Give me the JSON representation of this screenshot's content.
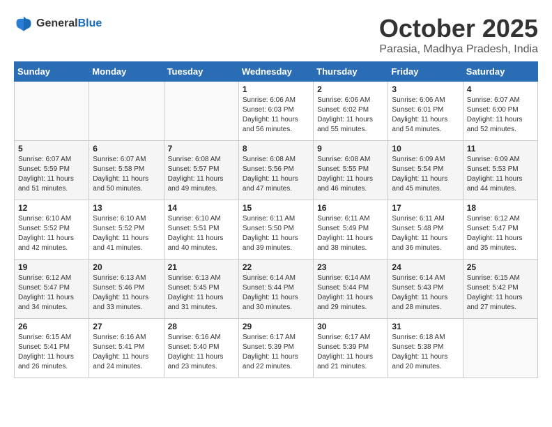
{
  "header": {
    "logo_general": "General",
    "logo_blue": "Blue",
    "title": "October 2025",
    "subtitle": "Parasia, Madhya Pradesh, India"
  },
  "days_of_week": [
    "Sunday",
    "Monday",
    "Tuesday",
    "Wednesday",
    "Thursday",
    "Friday",
    "Saturday"
  ],
  "weeks": [
    [
      {
        "day": "",
        "sunrise": "",
        "sunset": "",
        "daylight": ""
      },
      {
        "day": "",
        "sunrise": "",
        "sunset": "",
        "daylight": ""
      },
      {
        "day": "",
        "sunrise": "",
        "sunset": "",
        "daylight": ""
      },
      {
        "day": "1",
        "sunrise": "Sunrise: 6:06 AM",
        "sunset": "Sunset: 6:03 PM",
        "daylight": "Daylight: 11 hours and 56 minutes."
      },
      {
        "day": "2",
        "sunrise": "Sunrise: 6:06 AM",
        "sunset": "Sunset: 6:02 PM",
        "daylight": "Daylight: 11 hours and 55 minutes."
      },
      {
        "day": "3",
        "sunrise": "Sunrise: 6:06 AM",
        "sunset": "Sunset: 6:01 PM",
        "daylight": "Daylight: 11 hours and 54 minutes."
      },
      {
        "day": "4",
        "sunrise": "Sunrise: 6:07 AM",
        "sunset": "Sunset: 6:00 PM",
        "daylight": "Daylight: 11 hours and 52 minutes."
      }
    ],
    [
      {
        "day": "5",
        "sunrise": "Sunrise: 6:07 AM",
        "sunset": "Sunset: 5:59 PM",
        "daylight": "Daylight: 11 hours and 51 minutes."
      },
      {
        "day": "6",
        "sunrise": "Sunrise: 6:07 AM",
        "sunset": "Sunset: 5:58 PM",
        "daylight": "Daylight: 11 hours and 50 minutes."
      },
      {
        "day": "7",
        "sunrise": "Sunrise: 6:08 AM",
        "sunset": "Sunset: 5:57 PM",
        "daylight": "Daylight: 11 hours and 49 minutes."
      },
      {
        "day": "8",
        "sunrise": "Sunrise: 6:08 AM",
        "sunset": "Sunset: 5:56 PM",
        "daylight": "Daylight: 11 hours and 47 minutes."
      },
      {
        "day": "9",
        "sunrise": "Sunrise: 6:08 AM",
        "sunset": "Sunset: 5:55 PM",
        "daylight": "Daylight: 11 hours and 46 minutes."
      },
      {
        "day": "10",
        "sunrise": "Sunrise: 6:09 AM",
        "sunset": "Sunset: 5:54 PM",
        "daylight": "Daylight: 11 hours and 45 minutes."
      },
      {
        "day": "11",
        "sunrise": "Sunrise: 6:09 AM",
        "sunset": "Sunset: 5:53 PM",
        "daylight": "Daylight: 11 hours and 44 minutes."
      }
    ],
    [
      {
        "day": "12",
        "sunrise": "Sunrise: 6:10 AM",
        "sunset": "Sunset: 5:52 PM",
        "daylight": "Daylight: 11 hours and 42 minutes."
      },
      {
        "day": "13",
        "sunrise": "Sunrise: 6:10 AM",
        "sunset": "Sunset: 5:52 PM",
        "daylight": "Daylight: 11 hours and 41 minutes."
      },
      {
        "day": "14",
        "sunrise": "Sunrise: 6:10 AM",
        "sunset": "Sunset: 5:51 PM",
        "daylight": "Daylight: 11 hours and 40 minutes."
      },
      {
        "day": "15",
        "sunrise": "Sunrise: 6:11 AM",
        "sunset": "Sunset: 5:50 PM",
        "daylight": "Daylight: 11 hours and 39 minutes."
      },
      {
        "day": "16",
        "sunrise": "Sunrise: 6:11 AM",
        "sunset": "Sunset: 5:49 PM",
        "daylight": "Daylight: 11 hours and 38 minutes."
      },
      {
        "day": "17",
        "sunrise": "Sunrise: 6:11 AM",
        "sunset": "Sunset: 5:48 PM",
        "daylight": "Daylight: 11 hours and 36 minutes."
      },
      {
        "day": "18",
        "sunrise": "Sunrise: 6:12 AM",
        "sunset": "Sunset: 5:47 PM",
        "daylight": "Daylight: 11 hours and 35 minutes."
      }
    ],
    [
      {
        "day": "19",
        "sunrise": "Sunrise: 6:12 AM",
        "sunset": "Sunset: 5:47 PM",
        "daylight": "Daylight: 11 hours and 34 minutes."
      },
      {
        "day": "20",
        "sunrise": "Sunrise: 6:13 AM",
        "sunset": "Sunset: 5:46 PM",
        "daylight": "Daylight: 11 hours and 33 minutes."
      },
      {
        "day": "21",
        "sunrise": "Sunrise: 6:13 AM",
        "sunset": "Sunset: 5:45 PM",
        "daylight": "Daylight: 11 hours and 31 minutes."
      },
      {
        "day": "22",
        "sunrise": "Sunrise: 6:14 AM",
        "sunset": "Sunset: 5:44 PM",
        "daylight": "Daylight: 11 hours and 30 minutes."
      },
      {
        "day": "23",
        "sunrise": "Sunrise: 6:14 AM",
        "sunset": "Sunset: 5:44 PM",
        "daylight": "Daylight: 11 hours and 29 minutes."
      },
      {
        "day": "24",
        "sunrise": "Sunrise: 6:14 AM",
        "sunset": "Sunset: 5:43 PM",
        "daylight": "Daylight: 11 hours and 28 minutes."
      },
      {
        "day": "25",
        "sunrise": "Sunrise: 6:15 AM",
        "sunset": "Sunset: 5:42 PM",
        "daylight": "Daylight: 11 hours and 27 minutes."
      }
    ],
    [
      {
        "day": "26",
        "sunrise": "Sunrise: 6:15 AM",
        "sunset": "Sunset: 5:41 PM",
        "daylight": "Daylight: 11 hours and 26 minutes."
      },
      {
        "day": "27",
        "sunrise": "Sunrise: 6:16 AM",
        "sunset": "Sunset: 5:41 PM",
        "daylight": "Daylight: 11 hours and 24 minutes."
      },
      {
        "day": "28",
        "sunrise": "Sunrise: 6:16 AM",
        "sunset": "Sunset: 5:40 PM",
        "daylight": "Daylight: 11 hours and 23 minutes."
      },
      {
        "day": "29",
        "sunrise": "Sunrise: 6:17 AM",
        "sunset": "Sunset: 5:39 PM",
        "daylight": "Daylight: 11 hours and 22 minutes."
      },
      {
        "day": "30",
        "sunrise": "Sunrise: 6:17 AM",
        "sunset": "Sunset: 5:39 PM",
        "daylight": "Daylight: 11 hours and 21 minutes."
      },
      {
        "day": "31",
        "sunrise": "Sunrise: 6:18 AM",
        "sunset": "Sunset: 5:38 PM",
        "daylight": "Daylight: 11 hours and 20 minutes."
      },
      {
        "day": "",
        "sunrise": "",
        "sunset": "",
        "daylight": ""
      }
    ]
  ]
}
